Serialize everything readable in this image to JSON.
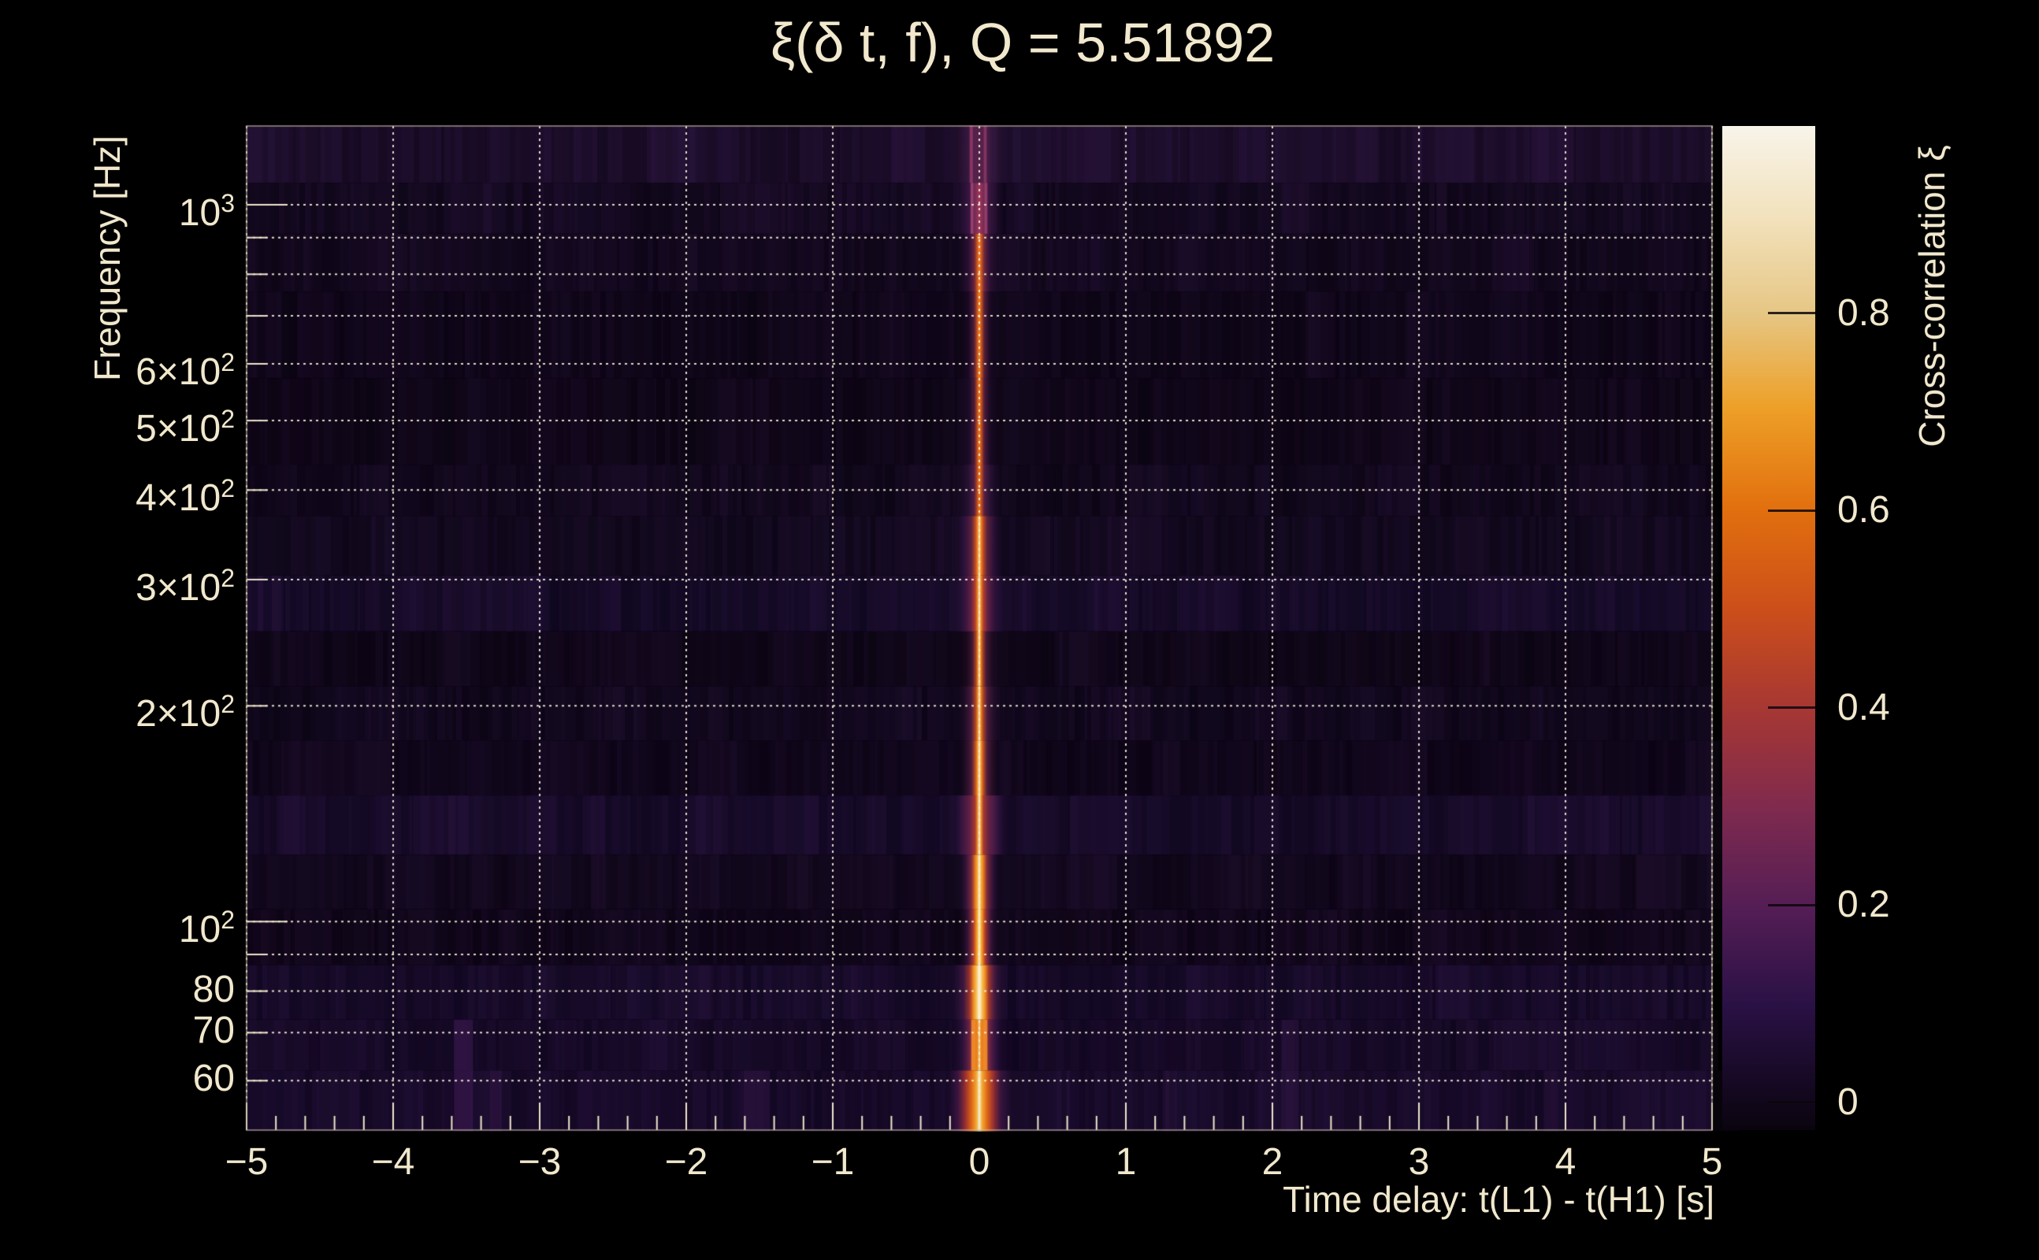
{
  "title": {
    "text": "ξ(δ t, f), Q = 5.51892"
  },
  "colors": {
    "background": "#000000",
    "text": "#f1e8cd",
    "grid": "rgba(246,238,216,0.92)",
    "tick": "#efe6cb",
    "frame": "rgba(200,190,166,0.55)",
    "heatmap_floor": "#0b0412"
  },
  "axes": {
    "x": {
      "title": "Time delay: t(L1) - t(H1) [s]",
      "min": -5,
      "max": 5,
      "minor_step": 0.2,
      "ticks": [
        {
          "v": -5,
          "label": "−5"
        },
        {
          "v": -4,
          "label": "−4"
        },
        {
          "v": -3,
          "label": "−3"
        },
        {
          "v": -2,
          "label": "−2"
        },
        {
          "v": -1,
          "label": "−1"
        },
        {
          "v": 0,
          "label": "0"
        },
        {
          "v": 1,
          "label": "1"
        },
        {
          "v": 2,
          "label": "2"
        },
        {
          "v": 3,
          "label": "3"
        },
        {
          "v": 4,
          "label": "4"
        },
        {
          "v": 5,
          "label": "5"
        }
      ]
    },
    "y": {
      "title": "Frequency [Hz]",
      "scale": "log",
      "min": 51.2,
      "max": 1288,
      "gridlines": [
        60,
        70,
        80,
        90,
        100,
        200,
        300,
        400,
        500,
        600,
        700,
        800,
        900,
        1000
      ],
      "ticks": [
        {
          "v": 1000,
          "label": "10^3"
        },
        {
          "v": 600,
          "label": "6×10^2"
        },
        {
          "v": 500,
          "label": "5×10^2"
        },
        {
          "v": 400,
          "label": "4×10^2"
        },
        {
          "v": 300,
          "label": "3×10^2"
        },
        {
          "v": 200,
          "label": "2×10^2"
        },
        {
          "v": 100,
          "label": "10^2"
        },
        {
          "v": 80,
          "label": "80"
        },
        {
          "v": 70,
          "label": "70"
        },
        {
          "v": 60,
          "label": "60"
        }
      ]
    }
  },
  "colorbar": {
    "title": "Cross-correlation ξ",
    "min": -0.028,
    "max": 0.99,
    "ticks": [
      {
        "v": 0,
        "label": "0"
      },
      {
        "v": 0.2,
        "label": "0.2"
      },
      {
        "v": 0.4,
        "label": "0.4"
      },
      {
        "v": 0.6,
        "label": "0.6"
      },
      {
        "v": 0.8,
        "label": "0.8"
      }
    ],
    "gradient": [
      [
        0,
        "#0a040f"
      ],
      [
        0.125,
        "#2a1145"
      ],
      [
        0.224,
        "#551e55"
      ],
      [
        0.32,
        "#7f2a4e"
      ],
      [
        0.424,
        "#a83832"
      ],
      [
        0.52,
        "#cc4f1a"
      ],
      [
        0.62,
        "#e2700e"
      ],
      [
        0.72,
        "#eda028"
      ],
      [
        0.813,
        "#e6c684"
      ],
      [
        0.91,
        "#f2e2bd"
      ],
      [
        1,
        "#f8f4ea"
      ]
    ]
  },
  "chart_data": {
    "type": "heatmap",
    "title": "ξ(δ t, f), Q = 5.51892",
    "xlabel": "Time delay: t(L1) - t(H1) [s]",
    "ylabel": "Frequency [Hz]",
    "zlabel": "Cross-correlation ξ",
    "x_range_s": [
      -5,
      5
    ],
    "y_range_hz": [
      51.2,
      1288
    ],
    "z_range": [
      -0.028,
      0.99
    ],
    "description": "Strong cross-correlation ridge at time delay ≈ 0 s spanning all frequencies; near-zero noise background elsewhere; peak ξ ≈ 0.95 near 73–87 Hz.",
    "ridge": {
      "delay_s": 0,
      "rows": [
        {
          "f_range": [
            1073,
            1290
          ],
          "peak_xi": 0.15,
          "bg": "#160a21",
          "noise": 0.55,
          "stripe": {
            "half_s": 0.23,
            "stops": [
              [
                0,
                "rgba(94,37,80,0.85)"
              ],
              [
                0.18,
                "rgba(109,42,90,0.7)"
              ],
              [
                0.38,
                "rgba(70,32,78,0.55)"
              ],
              [
                0.7,
                "rgba(44,19,56,0.35)"
              ],
              [
                1,
                "rgba(22,10,33,0)"
              ]
            ],
            "accents": [
              {
                "dx": -0.055,
                "w": 0.022,
                "c": "rgba(150,60,110,0.8)"
              },
              {
                "dx": 0.04,
                "w": 0.02,
                "c": "rgba(150,60,110,0.7)"
              }
            ]
          }
        },
        {
          "f_range": [
            911,
            1073
          ],
          "peak_xi": 0.25,
          "bg": "#0f0719",
          "noise": 0.4,
          "stripe": {
            "half_s": 0.19,
            "stops": [
              [
                0,
                "rgba(168,58,96,0.95)"
              ],
              [
                0.15,
                "rgba(145,53,96,0.8)"
              ],
              [
                0.35,
                "rgba(80,31,82,0.6)"
              ],
              [
                0.7,
                "rgba(42,17,54,0.35)"
              ],
              [
                1,
                "rgba(15,7,25,0)"
              ]
            ],
            "accents": [
              {
                "dx": -0.05,
                "w": 0.02,
                "c": "rgba(170,70,120,0.8)"
              },
              {
                "dx": 0.045,
                "w": 0.02,
                "c": "rgba(170,70,120,0.7)"
              }
            ]
          }
        },
        {
          "f_range": [
            757,
            911
          ],
          "peak_xi": 0.5,
          "bg": "#0e0617",
          "noise": 0.35,
          "stripe": {
            "half_s": 0.17,
            "stops": [
              [
                0,
                "#f08428"
              ],
              [
                0.09,
                "rgba(212,88,30,0.95)"
              ],
              [
                0.2,
                "rgba(140,48,72,0.75)"
              ],
              [
                0.42,
                "rgba(68,25,74,0.55)"
              ],
              [
                1,
                "rgba(14,6,23,0)"
              ]
            ]
          }
        },
        {
          "f_range": [
            573,
            757
          ],
          "peak_xi": 0.5,
          "bg": "#0c0514",
          "noise": 0.3,
          "stripe": {
            "half_s": 0.15,
            "stops": [
              [
                0,
                "#f08a1f"
              ],
              [
                0.1,
                "rgba(207,85,32,0.95)"
              ],
              [
                0.24,
                "rgba(109,39,68,0.7)"
              ],
              [
                0.5,
                "rgba(44,17,56,0.4)"
              ],
              [
                1,
                "rgba(12,5,20,0)"
              ]
            ]
          }
        },
        {
          "f_range": [
            434,
            573
          ],
          "peak_xi": 0.5,
          "bg": "#0c0513",
          "noise": 0.3,
          "stripe": {
            "half_s": 0.14,
            "stops": [
              [
                0,
                "#ef8018"
              ],
              [
                0.1,
                "rgba(207,85,32,0.95)"
              ],
              [
                0.24,
                "rgba(109,39,68,0.7)"
              ],
              [
                0.5,
                "rgba(44,17,56,0.4)"
              ],
              [
                1,
                "rgba(12,5,19,0)"
              ]
            ]
          }
        },
        {
          "f_range": [
            368,
            434
          ],
          "peak_xi": 0.5,
          "bg": "#0d0616",
          "noise": 0.35,
          "stripe": {
            "half_s": 0.16,
            "stops": [
              [
                0,
                "#ee7d16"
              ],
              [
                0.09,
                "rgba(200,80,34,0.95)"
              ],
              [
                0.22,
                "rgba(112,40,80,0.7)"
              ],
              [
                0.5,
                "rgba(52,22,66,0.45)"
              ],
              [
                1,
                "rgba(13,6,22,0)"
              ]
            ]
          }
        },
        {
          "f_range": [
            304,
            368
          ],
          "peak_xi": 0.65,
          "bg": "#0e0718",
          "noise": 0.4,
          "stripe": {
            "half_s": 0.18,
            "stops": [
              [
                0,
                "#f5e8c8"
              ],
              [
                0.05,
                "#f59a2c"
              ],
              [
                0.13,
                "rgba(216,89,28,0.95)"
              ],
              [
                0.3,
                "rgba(124,44,76,0.7)"
              ],
              [
                0.6,
                "rgba(56,22,74,0.5)"
              ],
              [
                1,
                "rgba(14,7,24,0)"
              ]
            ]
          }
        },
        {
          "f_range": [
            254,
            304
          ],
          "peak_xi": 0.65,
          "bg": "#100820",
          "noise": 0.45,
          "stripe": {
            "half_s": 0.19,
            "stops": [
              [
                0,
                "#f8eed6"
              ],
              [
                0.05,
                "#f2992a"
              ],
              [
                0.14,
                "rgba(196,68,40,0.95)"
              ],
              [
                0.3,
                "rgba(124,40,80,0.75)"
              ],
              [
                0.6,
                "rgba(60,22,72,0.5)"
              ],
              [
                1,
                "rgba(16,8,30,0)"
              ]
            ]
          }
        },
        {
          "f_range": [
            213,
            254
          ],
          "peak_xi": 0.6,
          "bg": "#0c0513",
          "noise": 0.3,
          "stripe": {
            "half_s": 0.14,
            "stops": [
              [
                0,
                "#f6ecd0"
              ],
              [
                0.06,
                "#f29a2a"
              ],
              [
                0.15,
                "rgba(205,82,30,0.9)"
              ],
              [
                0.35,
                "rgba(96,34,70,0.6)"
              ],
              [
                1,
                "rgba(12,5,19,0)"
              ]
            ]
          }
        },
        {
          "f_range": [
            179,
            213
          ],
          "peak_xi": 0.6,
          "bg": "#0d0617",
          "noise": 0.35,
          "stripe": {
            "half_s": 0.15,
            "stops": [
              [
                0,
                "#f6ecd0"
              ],
              [
                0.06,
                "#f29a2a"
              ],
              [
                0.16,
                "rgba(205,82,30,0.9)"
              ],
              [
                0.36,
                "rgba(104,38,78,0.65)"
              ],
              [
                1,
                "rgba(13,6,23,0)"
              ]
            ]
          }
        },
        {
          "f_range": [
            150,
            179
          ],
          "peak_xi": 0.7,
          "bg": "#0d0516",
          "noise": 0.3,
          "stripe": {
            "half_s": 0.15,
            "stops": [
              [
                0,
                "#faf0d8"
              ],
              [
                0.07,
                "#f4a432"
              ],
              [
                0.16,
                "rgba(220,95,26,0.95)"
              ],
              [
                0.36,
                "rgba(110,40,80,0.65)"
              ],
              [
                1,
                "rgba(13,5,22,0)"
              ]
            ]
          }
        },
        {
          "f_range": [
            124,
            150
          ],
          "peak_xi": 0.65,
          "bg": "#110821",
          "noise": 0.45,
          "stripe": {
            "half_s": 0.22,
            "stops": [
              [
                0,
                "#f8eed4"
              ],
              [
                0.05,
                "#f2992a"
              ],
              [
                0.13,
                "rgba(186,62,46,0.9)"
              ],
              [
                0.3,
                "rgba(130,42,80,0.7)"
              ],
              [
                0.62,
                "rgba(62,24,76,0.5)"
              ],
              [
                1,
                "rgba(17,8,33,0)"
              ]
            ]
          }
        },
        {
          "f_range": [
            104,
            124
          ],
          "peak_xi": 0.8,
          "bg": "#0e0617",
          "noise": 0.35,
          "stripe": {
            "half_s": 0.15,
            "stops": [
              [
                0,
                "#fbf2dc"
              ],
              [
                0.09,
                "#f5ae38"
              ],
              [
                0.18,
                "#ec7e1a"
              ],
              [
                0.36,
                "rgba(150,50,70,0.8)"
              ],
              [
                0.65,
                "rgba(70,26,76,0.5)"
              ],
              [
                1,
                "rgba(14,6,23,0)"
              ]
            ]
          }
        },
        {
          "f_range": [
            87,
            104
          ],
          "peak_xi": 0.85,
          "bg": "#0d0515",
          "noise": 0.3,
          "stripe": {
            "half_s": 0.14,
            "stops": [
              [
                0,
                "#fdf5e0"
              ],
              [
                0.08,
                "#f6b83e"
              ],
              [
                0.16,
                "#ee831c"
              ],
              [
                0.3,
                "rgba(180,60,48,0.9)"
              ],
              [
                0.55,
                "rgba(87,32,79,0.6)"
              ],
              [
                1,
                "rgba(13,5,21,0)"
              ]
            ]
          }
        },
        {
          "f_range": [
            73,
            87
          ],
          "peak_xi": 0.95,
          "bg": "#120822",
          "noise": 0.45,
          "stripe": {
            "half_s": 0.2,
            "stops": [
              [
                0,
                "#fdf7e6"
              ],
              [
                0.1,
                "#f6c054"
              ],
              [
                0.2,
                "#ef8a1e"
              ],
              [
                0.33,
                "rgba(180,60,48,0.85)"
              ],
              [
                0.55,
                "rgba(87,32,79,0.6)"
              ],
              [
                1,
                "rgba(18,8,34,0)"
              ]
            ]
          }
        },
        {
          "f_range": [
            62,
            73
          ],
          "peak_xi": 0.8,
          "bg": "#110720",
          "noise": 0.4,
          "stripe": {
            "half_s": 0.2,
            "stops": [
              [
                0,
                "#f3dfb4"
              ],
              [
                0.05,
                "#ee8e22"
              ],
              [
                0.18,
                "#e0661a"
              ],
              [
                0.32,
                "rgba(140,47,80,0.8)"
              ],
              [
                0.58,
                "rgba(64,24,76,0.55)"
              ],
              [
                1,
                "rgba(17,7,32,0)"
              ]
            ],
            "accents": [
              {
                "dx": -0.04,
                "w": 0.03,
                "c": "rgba(240,140,40,0.9)"
              },
              {
                "dx": 0.04,
                "w": 0.03,
                "c": "rgba(240,140,40,0.9)"
              }
            ]
          }
        },
        {
          "f_range": [
            51,
            62
          ],
          "peak_xi": 0.85,
          "bg": "#130823",
          "noise": 0.45,
          "stripe": {
            "half_s": 0.25,
            "stops": [
              [
                0,
                "#f9efd8"
              ],
              [
                0.07,
                "#f2ae38"
              ],
              [
                0.2,
                "#e46c16"
              ],
              [
                0.38,
                "rgba(168,52,48,0.9)"
              ],
              [
                0.6,
                "rgba(76,27,78,0.6)"
              ],
              [
                1,
                "rgba(19,8,35,0)"
              ]
            ]
          }
        }
      ]
    },
    "noise_patches": [
      {
        "t": -3.52,
        "f_range": [
          51,
          73
        ],
        "width_s": 0.13,
        "color": "rgba(70,30,92,0.5)"
      },
      {
        "t": -3.3,
        "f_range": [
          51,
          62
        ],
        "width_s": 0.08,
        "color": "rgba(60,26,80,0.45)"
      },
      {
        "t": -1.52,
        "f_range": [
          51,
          62
        ],
        "width_s": 0.18,
        "color": "rgba(50,22,68,0.5)"
      },
      {
        "t": 2.12,
        "f_range": [
          51,
          73
        ],
        "width_s": 0.12,
        "color": "rgba(54,24,74,0.45)"
      },
      {
        "t": 1.3,
        "f_range": [
          51,
          62
        ],
        "width_s": 0.1,
        "color": "rgba(46,20,62,0.4)"
      },
      {
        "t": -2.6,
        "f_range": [
          104,
          150
        ],
        "width_s": 0.1,
        "color": "rgba(44,20,60,0.35)"
      },
      {
        "t": 3.9,
        "f_range": [
          51,
          62
        ],
        "width_s": 0.1,
        "color": "rgba(44,20,60,0.4)"
      }
    ],
    "legend_position": "right-colorbar",
    "grid": "dotted, at decade/subdecade frequencies and integer delays"
  }
}
